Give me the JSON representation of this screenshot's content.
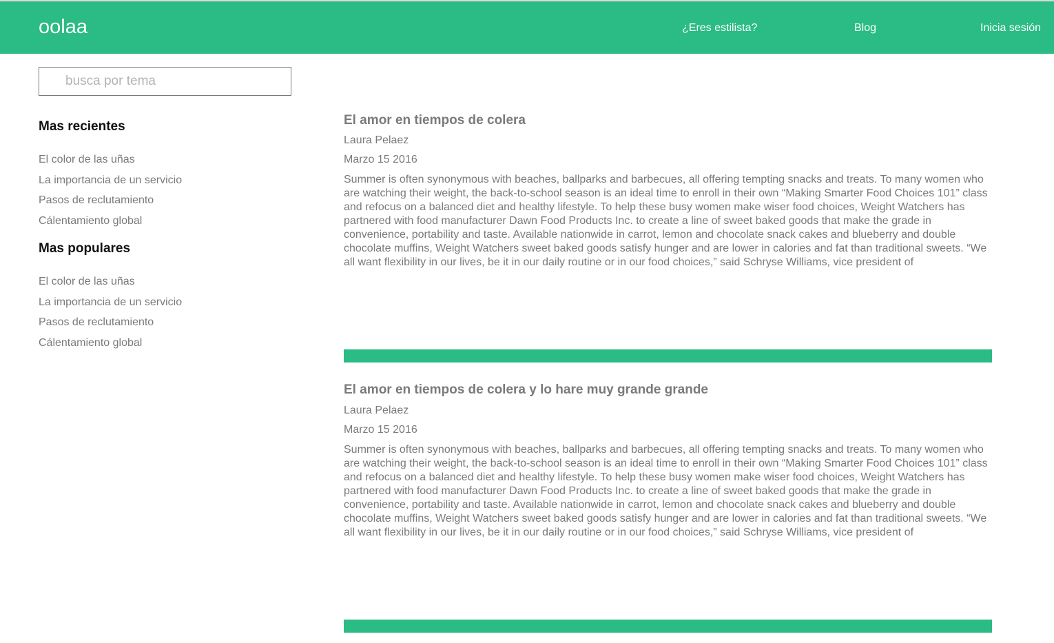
{
  "header": {
    "logo": "oolaa",
    "nav": {
      "stylist": "¿Eres estilista?",
      "blog": "Blog",
      "login": "Inicia sesión"
    }
  },
  "search": {
    "placeholder": "busca por tema",
    "value": ""
  },
  "sidebar": {
    "recent": {
      "heading": "Mas recientes",
      "items": [
        "El color de las uñas",
        "La importancia de un servicio",
        "Pasos de reclutamiento",
        "Cálentamiento global"
      ]
    },
    "popular": {
      "heading": "Mas populares",
      "items": [
        "El color de las uñas",
        "La importancia de un servicio",
        "Pasos de reclutamiento",
        "Cálentamiento global"
      ]
    }
  },
  "posts": [
    {
      "title": "El amor en tiempos de colera",
      "author": "Laura Pelaez",
      "date": "Marzo 15 2016",
      "excerpt": "Summer is often synonymous with beaches, ballparks and barbecues, all offering tempting snacks and treats. To many women who are watching their weight, the back-to-school season is an ideal time to enroll in their own “Making Smarter Food Choices 101” class and refocus on a balanced diet and healthy lifestyle. To help these busy women make wiser food choices, Weight Watchers has partnered with food manufacturer Dawn Food Products Inc. to create a line of sweet baked goods that make the grade in convenience, portability and taste. Available nationwide in carrot, lemon and chocolate snack cakes and blueberry and double chocolate muffins, Weight Watchers sweet baked goods satisfy hunger and are lower in calories and fat than traditional sweets. “We all want flexibility in our lives, be it in our daily routine or in our food choices,” said Schryse Williams, vice president of"
    },
    {
      "title": "El amor en tiempos de colera y lo hare muy grande grande",
      "author": "Laura Pelaez",
      "date": "Marzo 15 2016",
      "excerpt": "Summer is often synonymous with beaches, ballparks and barbecues, all offering tempting snacks and treats. To many women who are watching their weight, the back-to-school season is an ideal time to enroll in their own “Making Smarter Food Choices 101” class and refocus on a balanced diet and healthy lifestyle. To help these busy women make wiser food choices, Weight Watchers has partnered with food manufacturer Dawn Food Products Inc. to create a line of sweet baked goods that make the grade in convenience, portability and taste. Available nationwide in carrot, lemon and chocolate snack cakes and blueberry and double chocolate muffins, Weight Watchers sweet baked goods satisfy hunger and are lower in calories and fat than traditional sweets. “We all want flexibility in our lives, be it in our daily routine or in our food choices,” said Schryse Williams, vice president of"
    }
  ],
  "colors": {
    "brand": "#2bbb85",
    "text": "#7a7a7a",
    "heading": "#111111"
  }
}
